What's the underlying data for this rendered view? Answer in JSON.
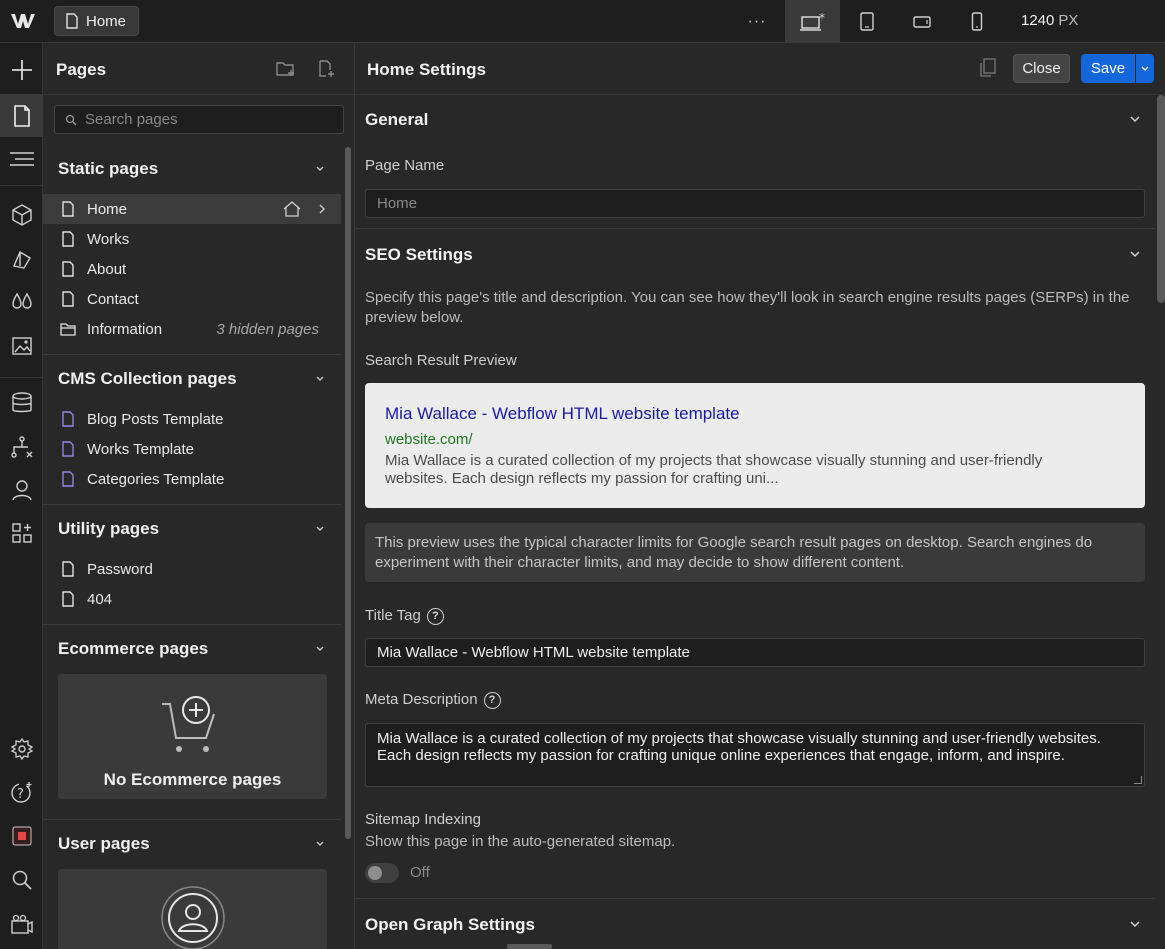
{
  "topbar": {
    "home_tab": "Home",
    "more": "···",
    "width_value": "1240",
    "width_unit": "PX",
    "breakpoints": [
      "desktop-star-icon",
      "tablet-icon",
      "mobile-landscape-icon",
      "mobile-portrait-icon"
    ]
  },
  "rail": {
    "items": [
      "add-icon",
      "pages-icon",
      "navigator-icon",
      "components-icon",
      "styles-icon",
      "variables-icon",
      "assets-icon",
      "cms-icon",
      "logic-icon",
      "users-icon",
      "apps-icon",
      "settings-icon",
      "help-icon",
      "record-icon",
      "search-icon",
      "video-icon"
    ]
  },
  "pages": {
    "title": "Pages",
    "search_placeholder": "Search pages",
    "static": {
      "title": "Static pages",
      "items": [
        {
          "label": "Home",
          "meta": ""
        },
        {
          "label": "Works",
          "meta": ""
        },
        {
          "label": "About",
          "meta": ""
        },
        {
          "label": "Contact",
          "meta": ""
        },
        {
          "label": "Information",
          "meta": "3 hidden pages"
        }
      ]
    },
    "cms": {
      "title": "CMS Collection pages",
      "items": [
        "Blog Posts Template",
        "Works Template",
        "Categories Template"
      ]
    },
    "utility": {
      "title": "Utility pages",
      "items": [
        "Password",
        "404"
      ]
    },
    "ecommerce": {
      "title": "Ecommerce pages",
      "empty": "No Ecommerce pages"
    },
    "user": {
      "title": "User pages"
    }
  },
  "settings": {
    "title": "Home Settings",
    "close": "Close",
    "save": "Save",
    "general": {
      "title": "General",
      "page_name_label": "Page Name",
      "page_name_placeholder": "Home"
    },
    "seo": {
      "title": "SEO Settings",
      "intro": "Specify this page's title and description. You can see how they'll look in search engine results pages (SERPs) in the preview below.",
      "preview_label": "Search Result Preview",
      "preview_title": "Mia Wallace - Webflow HTML website template",
      "preview_url": "website.com/",
      "preview_desc": "Mia Wallace is a curated collection of my projects that showcase visually stunning and user-friendly websites. Each design reflects my passion for crafting uni...",
      "note": "This preview uses the typical character limits for Google search result pages on desktop. Search engines do experiment with their character limits, and may decide to show different content.",
      "title_tag_label": "Title Tag",
      "title_tag_value": "Mia Wallace - Webflow HTML website template",
      "meta_desc_label": "Meta Description",
      "meta_desc_value": "Mia Wallace is a curated collection of my projects that showcase visually stunning and user-friendly websites. Each design reflects my passion for crafting unique online experiences that engage, inform, and inspire.",
      "sitemap_label": "Sitemap Indexing",
      "sitemap_desc": "Show this page in the auto-generated sitemap.",
      "sitemap_state": "Off"
    },
    "og": {
      "title": "Open Graph Settings"
    }
  }
}
